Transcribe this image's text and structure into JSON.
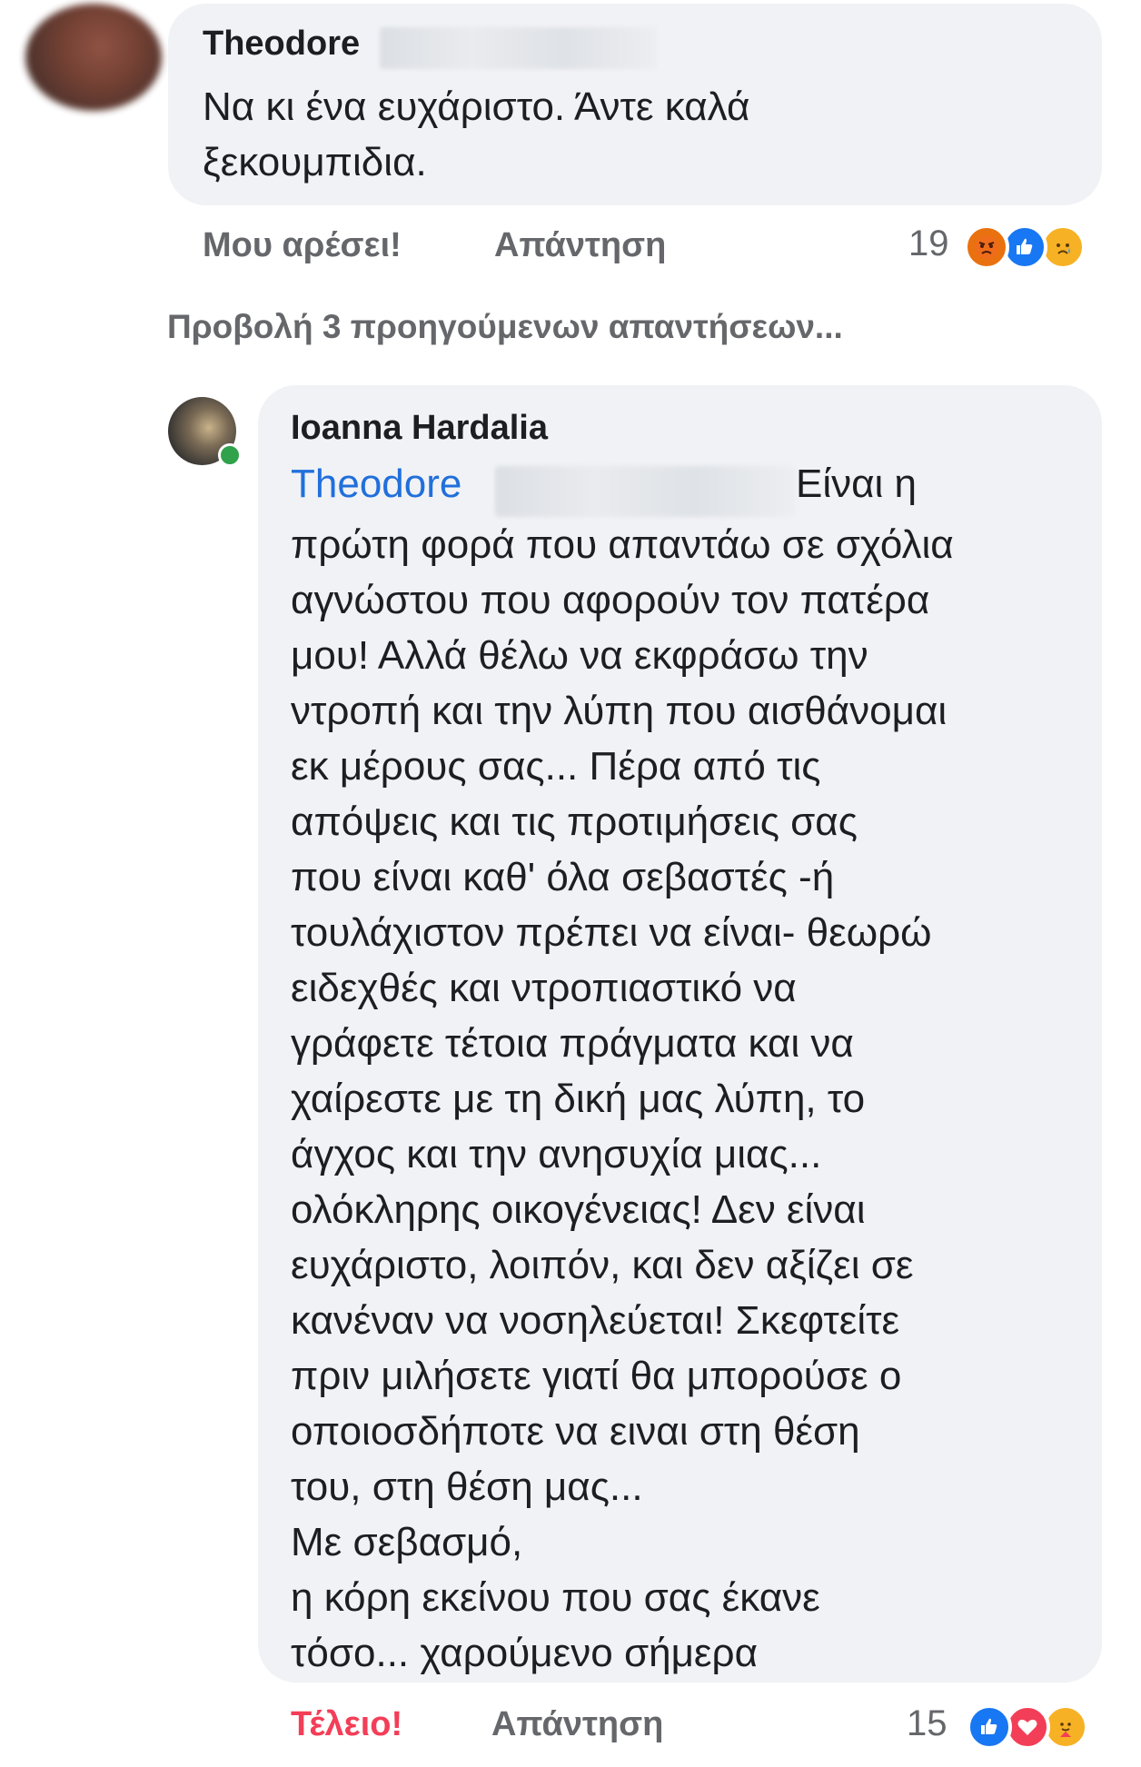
{
  "comments": [
    {
      "author": "Theodore",
      "text": "Να κι ένα ευχάριστο. Άντε καλά\nξεκουμπιδια.",
      "actions": {
        "like_label": "Μου αρέσει!",
        "reply_label": "Απάντηση"
      },
      "reactions": {
        "count": "19",
        "icons": [
          "angry-icon",
          "like-icon",
          "sad-icon"
        ]
      }
    }
  ],
  "view_previous_label": "Προβολή 3 προηγούμενων απαντήσεων...",
  "reply": {
    "author": "Ioanna Hardalia",
    "mention": "Theodore",
    "first_line_rest": "Είναι η",
    "text": "πρώτη φορά που απαντάω σε σχόλια\nαγνώστου που αφορούν τον πατέρα\nμου! Αλλά θέλω να εκφράσω την\nντροπή και την λύπη που αισθάνομαι\nεκ μέρους σας... Πέρα από τις\nαπόψεις και τις προτιμήσεις σας\nπου είναι καθ' όλα σεβαστές -ή\nτουλάχιστον πρέπει να είναι- θεωρώ\nειδεχθές και ντροπιαστικό να\nγράφετε τέτοια πράγματα και να\nχαίρεστε με τη δική μας λύπη, το\nάγχος και την ανησυχία μιας...\nολόκληρης οικογένειας! Δεν είναι\nευχάριστο, λοιπόν, και δεν αξίζει σε\nκανέναν να νοσηλεύεται! Σκεφτείτε\nπριν μιλήσετε γιατί θα μπορούσε ο\nοποιοσδήποτε να ειναι στη θέση\nτου, στη θέση μας...\nΜε σεβασμό,\nη κόρη εκείνου που σας έκανε\nτόσο... χαρούμενο σήμερα",
    "actions": {
      "like_label": "Τέλειο!",
      "reply_label": "Απάντηση"
    },
    "reactions": {
      "count": "15",
      "icons": [
        "like-icon",
        "love-icon",
        "care-icon"
      ]
    }
  },
  "colors": {
    "bubble": "#f0f2f5",
    "mention": "#216fdb",
    "reacted_like": "#f33e58",
    "secondary_text": "#65676b"
  }
}
